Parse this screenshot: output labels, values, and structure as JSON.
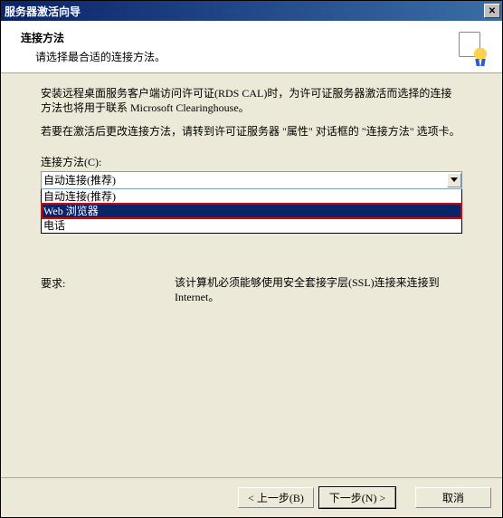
{
  "titlebar": {
    "title": "服务器激活向导",
    "close": "✕"
  },
  "header": {
    "h1": "连接方法",
    "h2": "请选择最合适的连接方法。"
  },
  "body": {
    "para1": "安装远程桌面服务客户端访问许可证(RDS CAL)时，为许可证服务器激活而选择的连接方法也将用于联系 Microsoft Clearinghouse。",
    "para2": "若要在激活后更改连接方法，请转到许可证服务器 \"属性\" 对话框的 \"连接方法\" 选项卡。",
    "combo_label": "连接方法(C):",
    "combo_selected": "自动连接(推荐)",
    "options": [
      "自动连接(推荐)",
      "Web 浏览器",
      "电话"
    ],
    "highlight_index": 1,
    "req_label": "要求:",
    "req_text": "该计算机必须能够使用安全套接字层(SSL)连接来连接到 Internet。"
  },
  "footer": {
    "back": "< 上一步(B)",
    "next": "下一步(N) >",
    "cancel": "取消"
  }
}
